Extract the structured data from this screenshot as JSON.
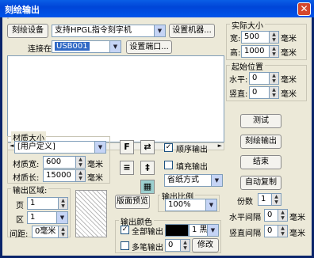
{
  "window": {
    "title": "刻绘输出",
    "close_glyph": "✕"
  },
  "device": {
    "button_label": "刻绘设备",
    "selected": "支持HPGL指令刻字机",
    "setup_label": "设置机器..."
  },
  "port": {
    "label": "连接在",
    "selected": "USB001",
    "setup_label": "设置端口..."
  },
  "actual_size": {
    "title": "实际大小",
    "width_label": "宽:",
    "width_value": "500",
    "height_label": "高:",
    "height_value": "1000",
    "unit": "毫米"
  },
  "start_pos": {
    "title": "起始位置",
    "h_label": "水平:",
    "h_value": "0",
    "v_label": "竖直:",
    "v_value": "0",
    "unit": "毫米"
  },
  "material": {
    "title": "材质大小",
    "preset": "[用户定义]",
    "width_label": "材质宽:",
    "width_value": "600",
    "length_label": "材质长:",
    "length_value": "15000",
    "unit": "毫米"
  },
  "options": {
    "order_label": "顺序输出",
    "order_checked": true,
    "fill_label": "填充输出",
    "fill_checked": false,
    "fill_mode": "省纸方式"
  },
  "output_area": {
    "title": "输出区域:",
    "page_label": "页",
    "page_value": "1",
    "area_label": "区",
    "area_value": "1",
    "spacing_label": "间距:",
    "spacing_value": "0毫米"
  },
  "preview_btn": "版面预览",
  "scale": {
    "title": "输出比例",
    "value": "100%"
  },
  "color": {
    "title": "输出颜色",
    "all_label": "全部输出",
    "all_checked": true,
    "color_name": "1 黑",
    "multi_label": "多笔输出",
    "multi_value": "0",
    "modify_label": "修改"
  },
  "actions": {
    "test": "测试",
    "output": "刻绘输出",
    "end": "结束",
    "auto": "自动复制"
  },
  "copies": {
    "count_label": "份数",
    "count_value": "1",
    "h_gap_label": "水平间隔",
    "h_gap_value": "0",
    "v_gap_label": "竖直间隔",
    "v_gap_value": "0",
    "unit": "毫米"
  },
  "colors": {
    "title_bar": "#0055ea",
    "dialog_bg": "#ece9d8",
    "button_face": "#f4f3ee"
  }
}
